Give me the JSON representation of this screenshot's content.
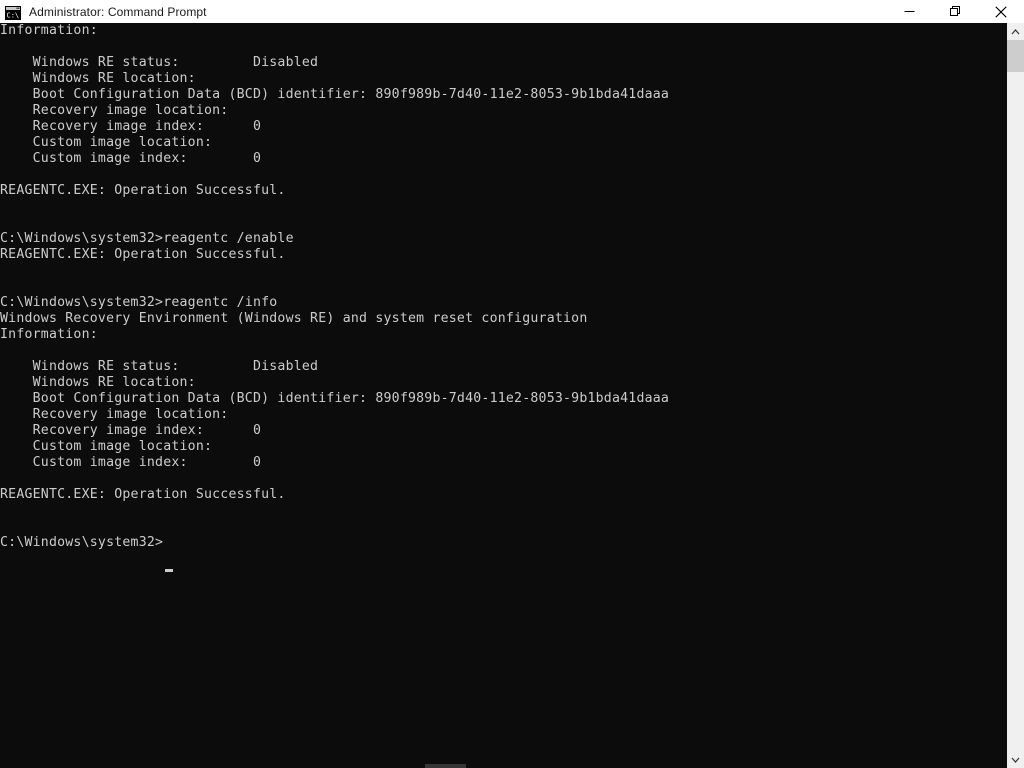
{
  "window": {
    "title": "Administrator: Command Prompt",
    "icon": "command-prompt-icon",
    "icon_label": "C:\\",
    "background_color": "#0c0c0c",
    "text_color": "#cccccc",
    "titlebar_color": "#ffffff"
  },
  "controls": {
    "minimize_label": "Minimize",
    "restore_label": "Restore",
    "close_label": "Close"
  },
  "scrollbar": {
    "vertical": {
      "up_arrow": "scroll-up-arrow",
      "down_arrow": "scroll-down-arrow",
      "thumb_color": "#cdcdcd",
      "track_color": "#f0f0f0"
    },
    "horizontal": {
      "thumb_color": "#5a5a5a"
    }
  },
  "terminal": {
    "prompt": "C:\\Windows\\system32>",
    "cursor": "_",
    "lines": [
      "Information:",
      "",
      "    Windows RE status:         Disabled",
      "    Windows RE location:",
      "    Boot Configuration Data (BCD) identifier: 890f989b-7d40-11e2-8053-9b1bda41daaa",
      "    Recovery image location:",
      "    Recovery image index:      0",
      "    Custom image location:",
      "    Custom image index:        0",
      "",
      "REAGENTC.EXE: Operation Successful.",
      "",
      "",
      "C:\\Windows\\system32>reagentc /enable",
      "REAGENTC.EXE: Operation Successful.",
      "",
      "",
      "C:\\Windows\\system32>reagentc /info",
      "Windows Recovery Environment (Windows RE) and system reset configuration",
      "Information:",
      "",
      "    Windows RE status:         Disabled",
      "    Windows RE location:",
      "    Boot Configuration Data (BCD) identifier: 890f989b-7d40-11e2-8053-9b1bda41daaa",
      "    Recovery image location:",
      "    Recovery image index:      0",
      "    Custom image location:",
      "    Custom image index:        0",
      "",
      "REAGENTC.EXE: Operation Successful.",
      "",
      "",
      "C:\\Windows\\system32>"
    ]
  }
}
